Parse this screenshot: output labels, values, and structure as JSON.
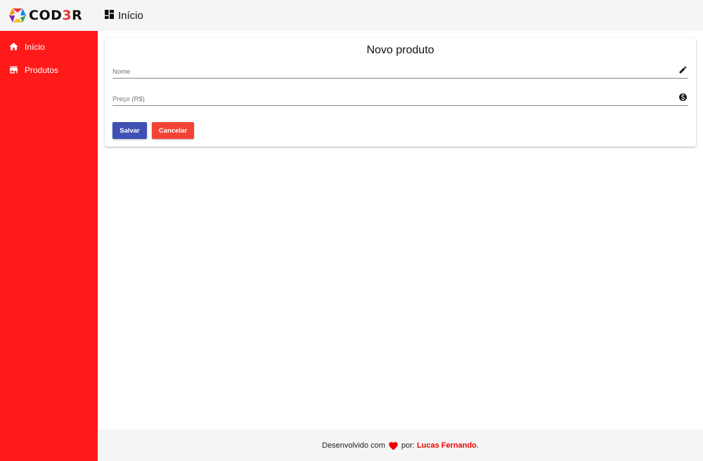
{
  "header": {
    "logo_text_main": "COD",
    "logo_text_accent": "3",
    "logo_text_end": "R",
    "logo_icon": "cube-logo-icon",
    "title_icon": "dashboard-icon",
    "title": "Início"
  },
  "sidebar": {
    "items": [
      {
        "icon": "home-icon",
        "label": "Início"
      },
      {
        "icon": "store-icon",
        "label": "Produtos"
      }
    ]
  },
  "form": {
    "title": "Novo produto",
    "name_field": {
      "placeholder": "Nome",
      "value": "",
      "icon": "pencil-icon"
    },
    "price_field": {
      "placeholder": "Preço (R$)",
      "value": "",
      "icon": "dollar-circle-icon"
    },
    "save_label": "Salvar",
    "cancel_label": "Cancelar"
  },
  "footer": {
    "text_before": "Desenvolvido com",
    "heart_icon": "heart-icon",
    "text_after": "por:",
    "author": "Lucas Fernando",
    "period": "."
  },
  "colors": {
    "sidebar_bg": "#ff1a1a",
    "header_bg": "#f5f5f5",
    "save_button": "#3f51b5",
    "cancel_button": "#f44336",
    "author": "#ee0000"
  }
}
